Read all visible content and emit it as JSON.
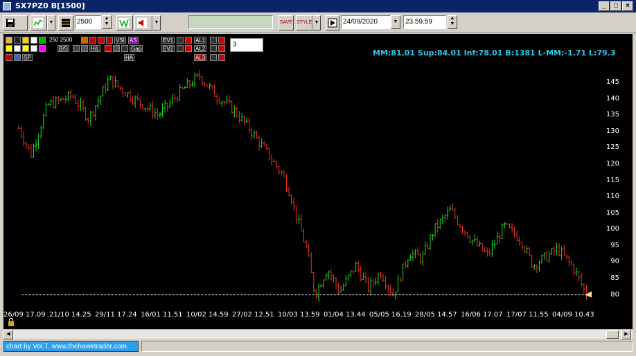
{
  "window": {
    "title": "SX7PZ0 B[1500]",
    "btn_minimize": "_",
    "btn_restore": "□",
    "btn_close": "×"
  },
  "toolbar": {
    "bars_value": "2500",
    "date_value": "24/09/2020",
    "time_value": "23.59.59",
    "save_label": "SAVE",
    "style_label": "STYLE"
  },
  "panel": {
    "bar_counts": "250 2500",
    "indicator_labels": [
      "B/S",
      "H/L",
      "Gap",
      "HA",
      "AS",
      "VSI",
      "EV1",
      "EV2",
      "AL1",
      "AL2",
      "AL3",
      "SP"
    ],
    "input_value": "3"
  },
  "stats": {
    "text": "MM:81.01 Sup:84.01 Inf:78.01 B:1381 L-MM:-1.71 L:79.3"
  },
  "chart_data": {
    "type": "bar",
    "style": "ohlc",
    "colors": {
      "up": "#22dd22",
      "down": "#ee3322",
      "background": "#000000",
      "axis_text": "#ffffff"
    },
    "ylim": [
      78,
      148
    ],
    "yticks": [
      80,
      85,
      90,
      95,
      100,
      105,
      110,
      115,
      120,
      125,
      130,
      135,
      140,
      145
    ],
    "xticks": [
      "26/09 17.09",
      "21/10 14.25",
      "29/11 17.24",
      "16/01 11.51",
      "10/02 14.59",
      "27/02 12.51",
      "10/03 13.59",
      "01/04 13.44",
      "05/05 16.19",
      "28/05 14.57",
      "16/06 17.07",
      "17/07 11.55",
      "04/09 10.43"
    ],
    "price_path": [
      [
        0,
        131
      ],
      [
        6,
        123
      ],
      [
        14,
        138
      ],
      [
        26,
        141
      ],
      [
        34,
        134
      ],
      [
        44,
        146
      ],
      [
        56,
        140
      ],
      [
        68,
        135
      ],
      [
        80,
        143
      ],
      [
        88,
        147
      ],
      [
        96,
        141
      ],
      [
        104,
        137
      ],
      [
        112,
        131
      ],
      [
        120,
        124
      ],
      [
        128,
        117
      ],
      [
        132,
        111
      ],
      [
        134,
        106
      ],
      [
        140,
        94
      ],
      [
        144,
        80
      ],
      [
        150,
        88
      ],
      [
        156,
        81
      ],
      [
        164,
        89
      ],
      [
        170,
        82
      ],
      [
        176,
        87
      ],
      [
        182,
        80
      ],
      [
        190,
        93
      ],
      [
        196,
        91
      ],
      [
        202,
        100
      ],
      [
        210,
        106
      ],
      [
        214,
        102
      ],
      [
        220,
        97
      ],
      [
        228,
        92
      ],
      [
        236,
        101
      ],
      [
        244,
        97
      ],
      [
        250,
        89
      ],
      [
        262,
        94
      ],
      [
        270,
        88
      ],
      [
        276,
        80
      ]
    ],
    "bar_count": 230,
    "marker_level": 80
  },
  "status": {
    "credit": "chart by Vol.T. www.thehawktrader.com"
  }
}
